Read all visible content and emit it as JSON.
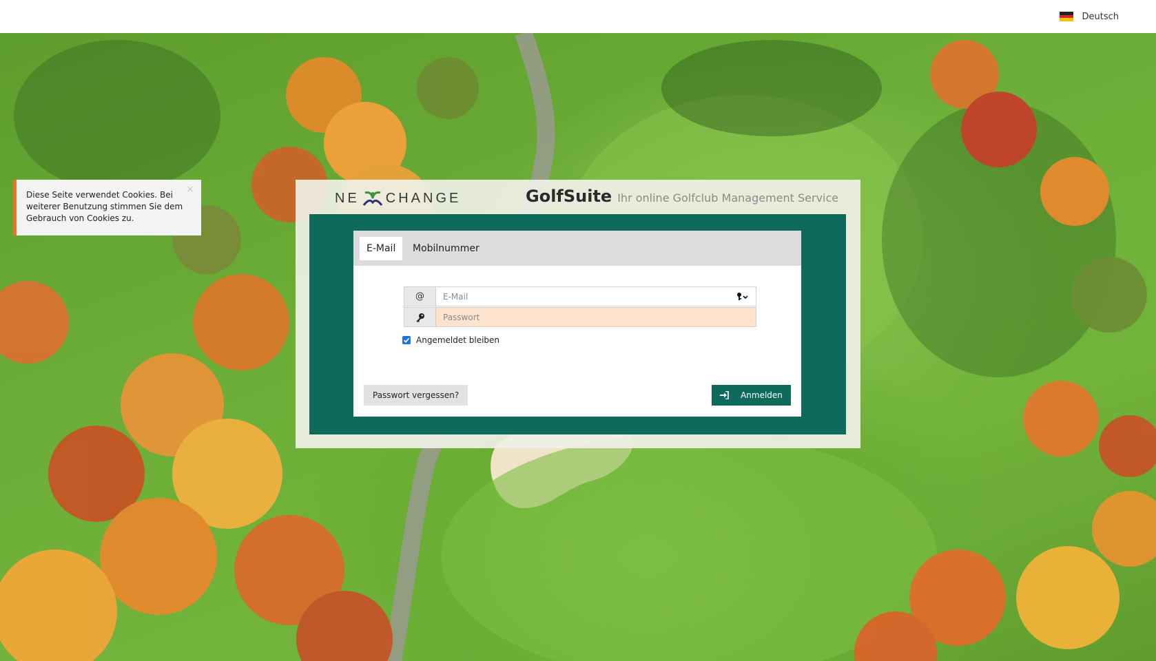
{
  "topbar": {
    "language_label": "Deutsch",
    "language_flag_icon": "flag-de-icon"
  },
  "cookie_notice": {
    "text": "Diese Seite verwendet Cookies. Bei weiterer Benutzung stimmen Sie dem Gebrauch von Cookies zu.",
    "close_label": "×",
    "accent_color": "#e8742c"
  },
  "header": {
    "logo_text_left": "NE",
    "logo_text_right": "CHANGE",
    "brand_name": "GolfSuite",
    "brand_tagline": "Ihr online Golfclub Management Service"
  },
  "tabs": [
    {
      "label": "E-Mail",
      "active": true
    },
    {
      "label": "Mobilnummer",
      "active": false
    }
  ],
  "form": {
    "email_addon": "@",
    "email_placeholder": "E-Mail",
    "email_value": "",
    "password_icon": "key-icon",
    "password_placeholder": "Passwort",
    "password_value": "",
    "remember_label": "Angemeldet bleiben",
    "remember_checked": true
  },
  "actions": {
    "forgot_label": "Passwort vergessen?",
    "login_label": "Anmelden",
    "login_icon": "sign-in-icon"
  },
  "colors": {
    "primary": "#0e6a5b",
    "password_field_bg": "#fde3cd",
    "checkbox": "#1d74d6"
  }
}
